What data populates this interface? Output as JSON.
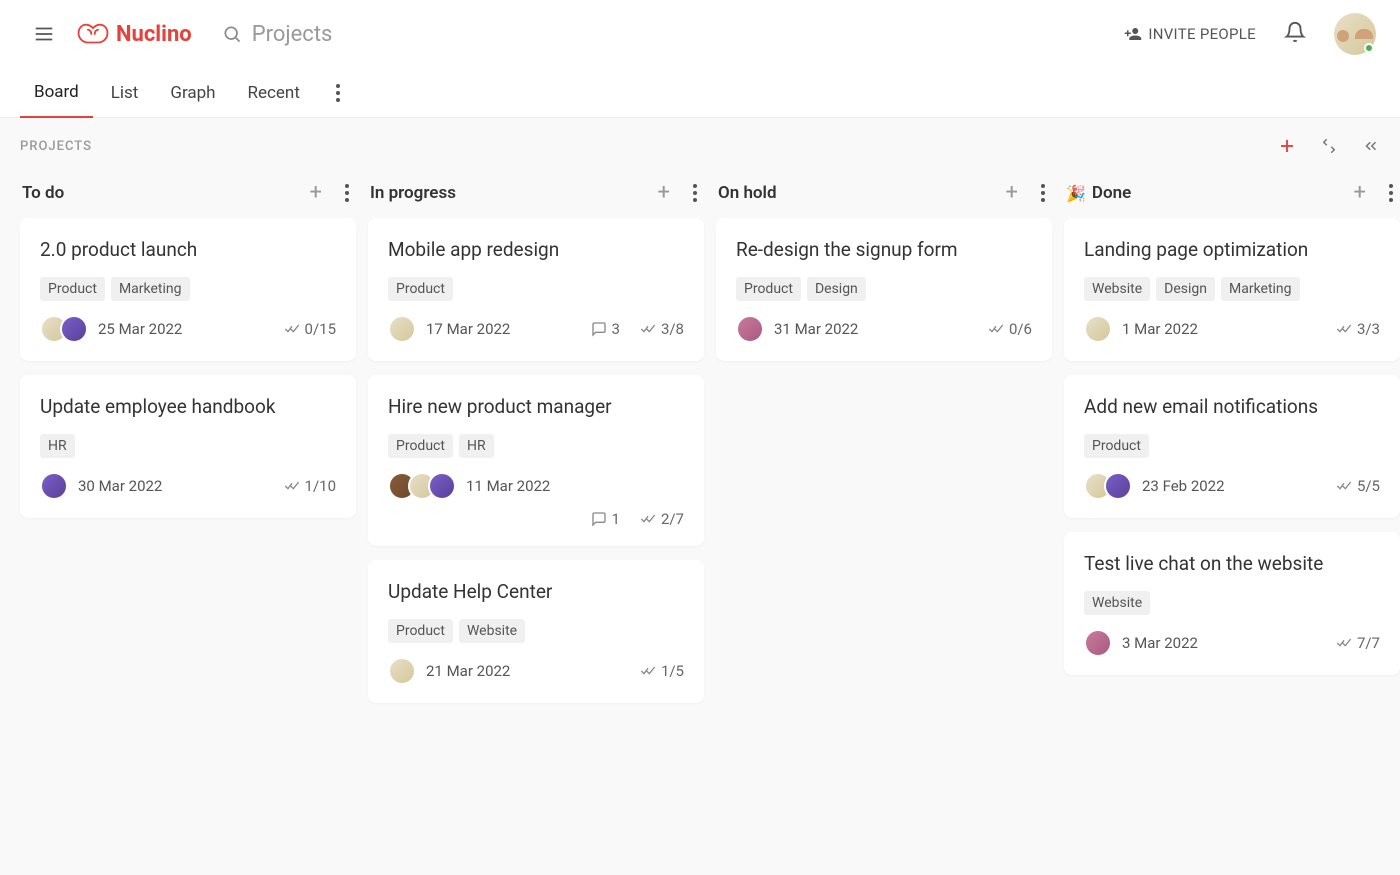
{
  "header": {
    "logo_text": "Nuclino",
    "search_title": "Projects",
    "invite_label": "INVITE PEOPLE"
  },
  "tabs": [
    "Board",
    "List",
    "Graph",
    "Recent"
  ],
  "active_tab": "Board",
  "breadcrumb": "PROJECTS",
  "columns": [
    {
      "title": "To do",
      "icon": "",
      "cards": [
        {
          "title": "2.0 product launch",
          "tags": [
            "Product",
            "Marketing"
          ],
          "avatars": [
            "av1",
            "av2"
          ],
          "date": "25 Mar 2022",
          "comments": null,
          "tasks": "0/15"
        },
        {
          "title": "Update employee handbook",
          "tags": [
            "HR"
          ],
          "avatars": [
            "av2"
          ],
          "date": "30 Mar 2022",
          "comments": null,
          "tasks": "1/10"
        }
      ]
    },
    {
      "title": "In progress",
      "icon": "",
      "cards": [
        {
          "title": "Mobile app redesign",
          "tags": [
            "Product"
          ],
          "avatars": [
            "av1"
          ],
          "date": "17 Mar 2022",
          "comments": "3",
          "tasks": "3/8"
        },
        {
          "title": "Hire new product manager",
          "tags": [
            "Product",
            "HR"
          ],
          "avatars": [
            "av3",
            "av1",
            "av2"
          ],
          "date": "11 Mar 2022",
          "comments": "1",
          "tasks": "2/7",
          "wrap": true
        },
        {
          "title": "Update Help Center",
          "tags": [
            "Product",
            "Website"
          ],
          "avatars": [
            "av1"
          ],
          "date": "21 Mar 2022",
          "comments": null,
          "tasks": "1/5"
        }
      ]
    },
    {
      "title": "On hold",
      "icon": "",
      "cards": [
        {
          "title": "Re-design the signup form",
          "tags": [
            "Product",
            "Design"
          ],
          "avatars": [
            "av4"
          ],
          "date": "31 Mar 2022",
          "comments": null,
          "tasks": "0/6"
        }
      ]
    },
    {
      "title": "Done",
      "icon": "🎉",
      "cards": [
        {
          "title": "Landing page optimization",
          "tags": [
            "Website",
            "Design",
            "Marketing"
          ],
          "avatars": [
            "av1"
          ],
          "date": "1 Mar 2022",
          "comments": null,
          "tasks": "3/3"
        },
        {
          "title": "Add new email notifications",
          "tags": [
            "Product"
          ],
          "avatars": [
            "av1",
            "av2"
          ],
          "date": "23 Feb 2022",
          "comments": null,
          "tasks": "5/5"
        },
        {
          "title": "Test live chat on the website",
          "tags": [
            "Website"
          ],
          "avatars": [
            "av4"
          ],
          "date": "3 Mar 2022",
          "comments": null,
          "tasks": "7/7"
        }
      ]
    }
  ]
}
